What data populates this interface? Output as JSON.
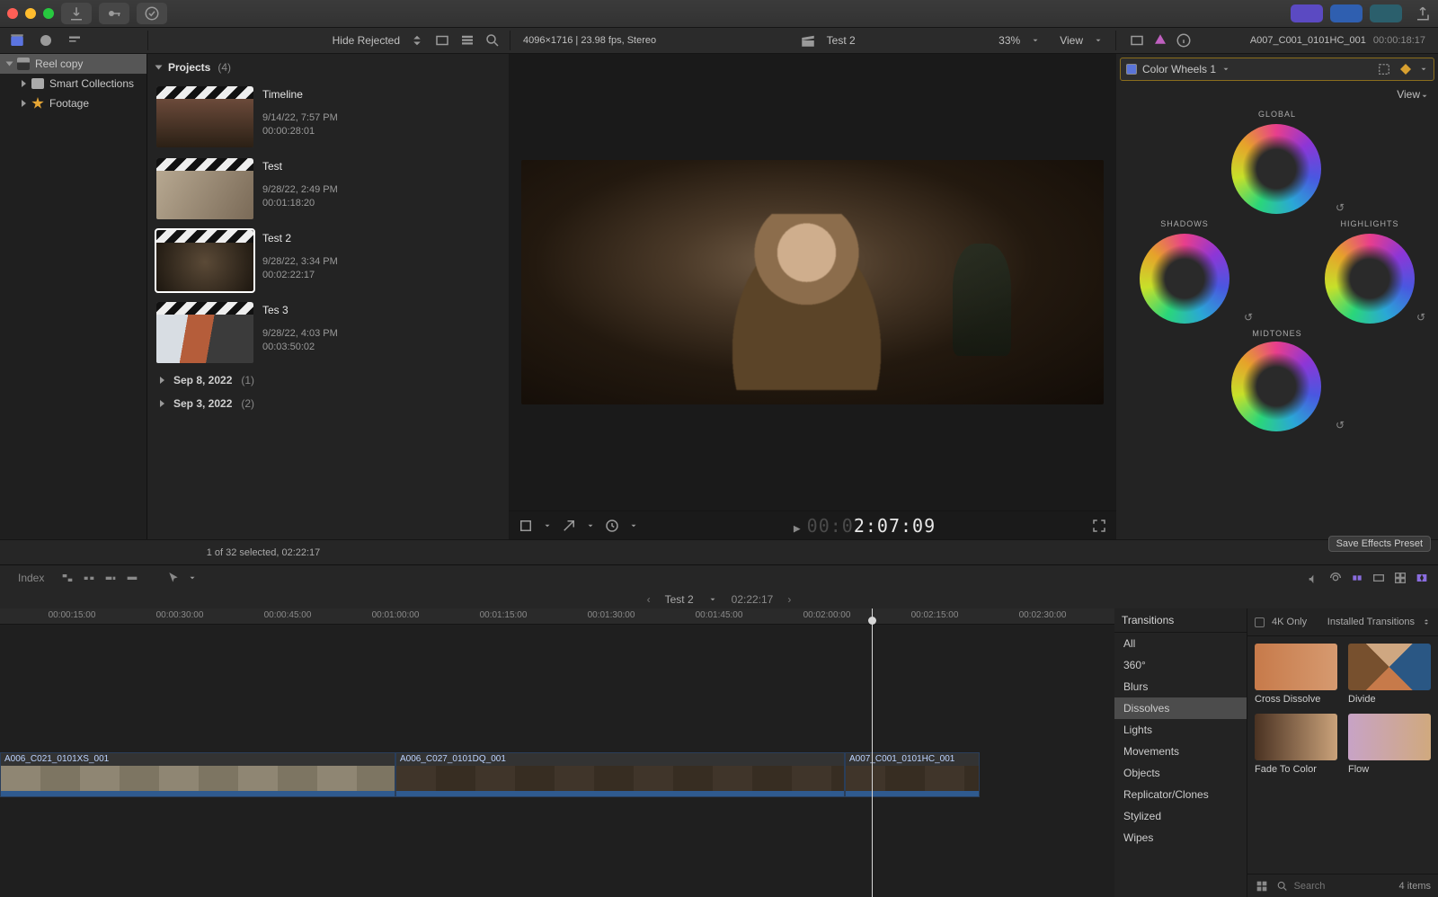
{
  "titlebar": {
    "download_icon": "download-icon",
    "key_icon": "key-icon"
  },
  "secondary": {
    "hide_rejected": "Hide Rejected",
    "viewer_meta": "4096×1716 | 23.98 fps, Stereo",
    "clip_name": "Test 2",
    "zoom": "33%",
    "view_label": "View",
    "inspector_clip": "A007_C001_0101HC_001",
    "inspector_tc": "00:00:18:17"
  },
  "sidebar": {
    "library": "Reel copy",
    "smart": "Smart Collections",
    "footage": "Footage"
  },
  "browser": {
    "header": "Projects",
    "header_count": "(4)",
    "projects": [
      {
        "title": "Timeline",
        "date": "9/14/22, 7:57 PM",
        "dur": "00:00:28:01",
        "thumb": "t1"
      },
      {
        "title": "Test",
        "date": "9/28/22, 2:49 PM",
        "dur": "00:01:18:20",
        "thumb": "t2"
      },
      {
        "title": "Test 2",
        "date": "9/28/22, 3:34 PM",
        "dur": "00:02:22:17",
        "thumb": "t3"
      },
      {
        "title": "Tes 3",
        "date": "9/28/22, 4:03 PM",
        "dur": "00:03:50:02",
        "thumb": "t4"
      }
    ],
    "groups": [
      {
        "label": "Sep 8, 2022",
        "count": "(1)"
      },
      {
        "label": "Sep 3, 2022",
        "count": "(2)"
      }
    ],
    "footer": "1 of 32 selected, 02:22:17"
  },
  "viewer": {
    "play_icon": "play-icon",
    "tc_prefix": "00:0",
    "tc": "2:07:09"
  },
  "inspector": {
    "effect_name": "Color Wheels 1",
    "view": "View",
    "wheel_global": "GLOBAL",
    "wheel_shadows": "SHADOWS",
    "wheel_highlights": "HIGHLIGHTS",
    "wheel_midtones": "MIDTONES",
    "save_preset": "Save Effects Preset"
  },
  "timeline": {
    "index": "Index",
    "title": "Test 2",
    "duration": "02:22:17",
    "ruler": [
      "00:00:15:00",
      "00:00:30:00",
      "00:00:45:00",
      "00:01:00:00",
      "00:01:15:00",
      "00:01:30:00",
      "00:01:45:00",
      "00:02:00:00",
      "00:02:15:00",
      "00:02:30:00"
    ],
    "clips": [
      {
        "name": "A006_C021_0101XS_001"
      },
      {
        "name": "A006_C027_0101DQ_001"
      },
      {
        "name": "A007_C001_0101HC_001"
      }
    ]
  },
  "effects": {
    "header": "Transitions",
    "filter_4k": "4K Only",
    "filter_installed": "Installed Transitions",
    "categories": [
      "All",
      "360°",
      "Blurs",
      "Dissolves",
      "Lights",
      "Movements",
      "Objects",
      "Replicator/Clones",
      "Stylized",
      "Wipes"
    ],
    "selected_cat": "Dissolves",
    "items": [
      {
        "name": "Cross Dissolve",
        "thumb": "xa"
      },
      {
        "name": "Divide",
        "thumb": "xb"
      },
      {
        "name": "Fade To Color",
        "thumb": "xc"
      },
      {
        "name": "Flow",
        "thumb": "xd"
      }
    ],
    "search_placeholder": "Search",
    "count": "4 items"
  }
}
